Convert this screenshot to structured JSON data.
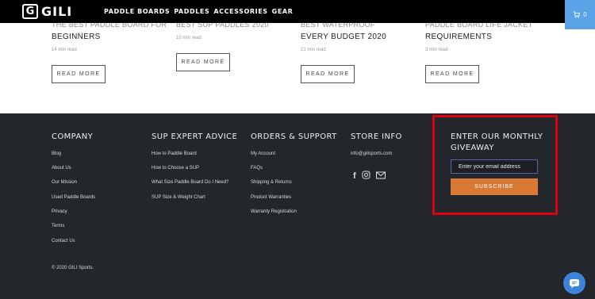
{
  "header": {
    "logo_mark": "G",
    "logo_text": "GILI",
    "nav": [
      "PADDLE BOARDS",
      "PADDLES",
      "ACCESSORIES",
      "GEAR"
    ],
    "cart_count": "0"
  },
  "articles": [
    {
      "title_cut": "The best paddle board for",
      "title": "BEGINNERS",
      "read_time": "14 min read",
      "button": "READ MORE"
    },
    {
      "title_cut": "Best SUP Paddles 2020",
      "title": "",
      "read_time": "10 min read",
      "button": "READ MORE"
    },
    {
      "title_cut": "Best Waterproof Backpacks for",
      "title": "EVERY BUDGET 2020",
      "read_time": "21 min read",
      "button": "READ MORE"
    },
    {
      "title_cut": "Paddle Board Life Jacket",
      "title": "REQUIREMENTS",
      "read_time": "3 min read",
      "button": "READ MORE"
    }
  ],
  "footer": {
    "columns": [
      {
        "title": "COMPANY",
        "links": [
          "Blog",
          "About Us",
          "Our Mission",
          "Used Paddle Boards",
          "Privacy",
          "Terms",
          "Contact Us"
        ]
      },
      {
        "title": "SUP EXPERT ADVICE",
        "links": [
          "How to Paddle Board",
          "How to Choose a SUP",
          "What Size Paddle Board Do I Need?",
          "SUP Size & Weight Chart"
        ]
      },
      {
        "title": "ORDERS & SUPPORT",
        "links": [
          "My Account",
          "FAQs",
          "Shipping & Returns",
          "Product Warranties",
          "Warranty Registration"
        ]
      },
      {
        "title": "STORE INFO",
        "links": [
          "info@gilisports.com"
        ]
      }
    ],
    "giveaway": {
      "title": "ENTER OUR MONTHLY GIVEAWAY",
      "email_placeholder": "Enter your email address",
      "button": "SUBSCRIBE"
    },
    "copyright": "© 2020 GILI Sports."
  }
}
